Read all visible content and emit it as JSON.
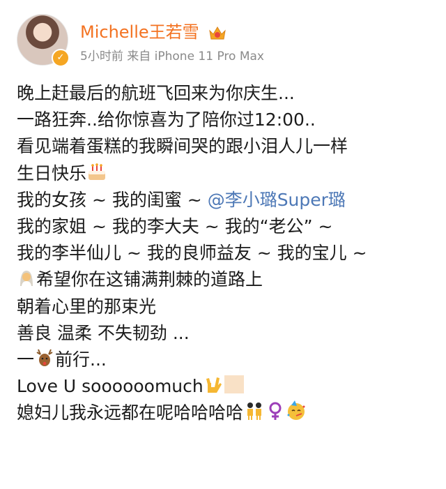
{
  "user": {
    "name": "Michelle王若雪",
    "time": "5小时前",
    "source_prefix": "来自",
    "device": "iPhone 11 Pro Max"
  },
  "post": {
    "lines": [
      {
        "text": "晚上赶最后的航班飞回来为你庆生..."
      },
      {
        "text": "一路狂奔..给你惊喜为了陪你过12:00.."
      },
      {
        "text": "看见端着蛋糕的我瞬间哭的跟小泪人儿一样"
      },
      {
        "text": "生日快乐",
        "emoji": "birthday-cake-icon"
      },
      {
        "text": "我的女孩 ~ 我的闺蜜 ~ ",
        "mention": "@李小璐Super璐"
      },
      {
        "text": "我的家姐 ~ 我的李大夫 ~ 我的“老公” ~"
      },
      {
        "text": "我的李半仙儿 ~ 我的良师益友 ~ 我的宝儿 ~"
      },
      {
        "text": "希望你在这铺满荆棘的道路上",
        "emoji_before": "person-with-veil-icon"
      },
      {
        "text": "朝着心里的那束光"
      },
      {
        "text": "善良 温柔 不失韧劲 ..."
      },
      {
        "text_a": "一",
        "text_b": "前行...",
        "emoji": "deer-icon"
      },
      {
        "text": "Love U soooooomuch",
        "emoji": "love-you-gesture-icon"
      },
      {
        "text": "媳妇儿我永远都在呢哈哈哈哈"
      }
    ]
  }
}
